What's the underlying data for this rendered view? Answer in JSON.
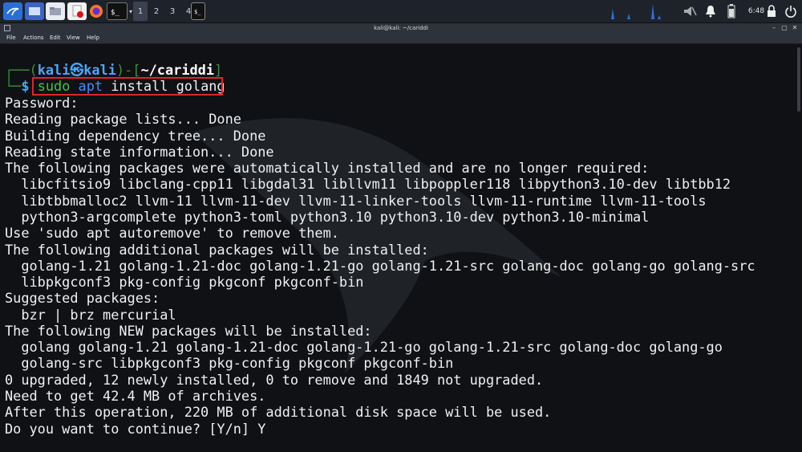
{
  "taskbar": {
    "workspaces": [
      "1",
      "2",
      "3",
      "4"
    ],
    "clock": "6:48"
  },
  "window": {
    "title": "kali@kali: ~/cariddi",
    "menu": [
      "File",
      "Actions",
      "Edit",
      "View",
      "Help"
    ]
  },
  "terminal": {
    "prompt": {
      "user": "kali",
      "at": "㉿",
      "host": "kali",
      "dir": "~/cariddi",
      "cmd_sudo": "sudo",
      "cmd_apt": "apt",
      "cmd_rest": "install golang"
    },
    "output": [
      "Password:",
      "Reading package lists... Done",
      "Building dependency tree... Done",
      "Reading state information... Done",
      "The following packages were automatically installed and are no longer required:",
      "  libcfitsio9 libclang-cpp11 libgdal31 libllvm11 libpoppler118 libpython3.10-dev libtbb12",
      "  libtbbmalloc2 llvm-11 llvm-11-dev llvm-11-linker-tools llvm-11-runtime llvm-11-tools",
      "  python3-argcomplete python3-toml python3.10 python3.10-dev python3.10-minimal",
      "Use 'sudo apt autoremove' to remove them.",
      "The following additional packages will be installed:",
      "  golang-1.21 golang-1.21-doc golang-1.21-go golang-1.21-src golang-doc golang-go golang-src",
      "  libpkgconf3 pkg-config pkgconf pkgconf-bin",
      "Suggested packages:",
      "  bzr | brz mercurial",
      "The following NEW packages will be installed:",
      "  golang golang-1.21 golang-1.21-doc golang-1.21-go golang-1.21-src golang-doc golang-go",
      "  golang-src libpkgconf3 pkg-config pkgconf pkgconf-bin",
      "0 upgraded, 12 newly installed, 0 to remove and 1849 not upgraded.",
      "Need to get 42.4 MB of archives.",
      "After this operation, 220 MB of additional disk space will be used.",
      "Do you want to continue? [Y/n] Y"
    ]
  },
  "colors": {
    "highlight": "#e0242a",
    "prompt_blue": "#3d8ff7",
    "prompt_green": "#3cc93c"
  }
}
